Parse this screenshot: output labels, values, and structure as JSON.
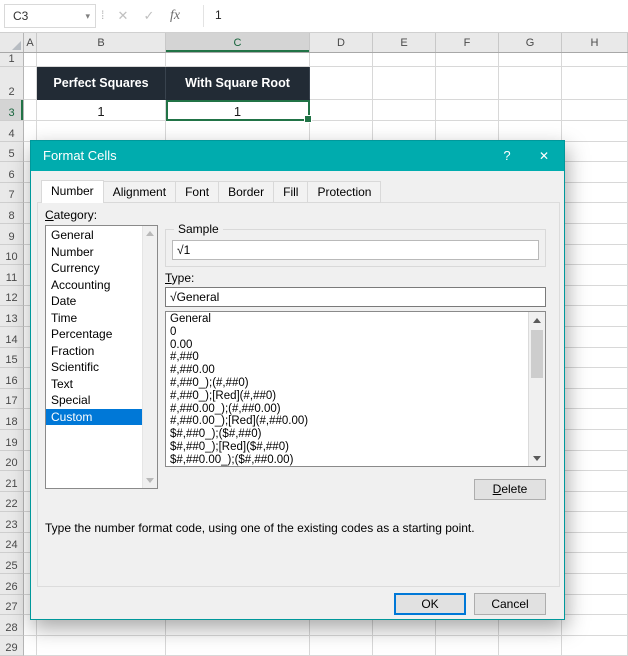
{
  "formula_bar": {
    "name_box": "C3",
    "value": "1",
    "icons": {
      "dropdown": "▾",
      "handle": "⁞",
      "cancel": "✕",
      "enter": "✓",
      "fx": "fx"
    }
  },
  "grid": {
    "columns": [
      "A",
      "B",
      "C",
      "D",
      "E",
      "F",
      "G",
      "H"
    ],
    "rows": [
      1,
      2,
      3,
      4,
      5,
      6,
      7,
      8,
      9,
      10,
      11,
      12,
      13,
      14,
      15,
      16,
      17,
      18,
      19,
      20,
      21,
      22,
      23,
      24,
      25,
      26,
      27,
      28,
      29
    ],
    "selected_column": "C",
    "selected_row": 3,
    "selected_cell": "C3",
    "dark_cells": [
      "B2",
      "C2"
    ],
    "cells": {
      "B2": "Perfect Squares",
      "C2": "With Square Root",
      "B3": "1",
      "C3": "1"
    }
  },
  "dialog": {
    "title": "Format Cells",
    "icons": {
      "help": "?",
      "close": "✕"
    },
    "tabs": [
      "Number",
      "Alignment",
      "Font",
      "Border",
      "Fill",
      "Protection"
    ],
    "active_tab": "Number",
    "category_label": "Category:",
    "categories": [
      "General",
      "Number",
      "Currency",
      "Accounting",
      "Date",
      "Time",
      "Percentage",
      "Fraction",
      "Scientific",
      "Text",
      "Special",
      "Custom"
    ],
    "selected_category": "Custom",
    "sample_label": "Sample",
    "sample_value": "√1",
    "type_label": "Type:",
    "type_value": "√General",
    "type_options": [
      "General",
      "0",
      "0.00",
      "#,##0",
      "#,##0.00",
      "#,##0_);(#,##0)",
      "#,##0_);[Red](#,##0)",
      "#,##0.00_);(#,##0.00)",
      "#,##0.00_);[Red](#,##0.00)",
      "$#,##0_);($#,##0)",
      "$#,##0_);[Red]($#,##0)",
      "$#,##0.00_);($#,##0.00)"
    ],
    "delete_button": "Delete",
    "help_text": "Type the number format code, using one of the existing codes as a starting point.",
    "ok_button": "OK",
    "cancel_button": "Cancel"
  },
  "colors": {
    "title_bar": "#00ACAE",
    "dialog_border": "#00989B",
    "selection_blue": "#0078D7",
    "excel_green": "#217346",
    "header_cell_bg": "#222B35"
  }
}
